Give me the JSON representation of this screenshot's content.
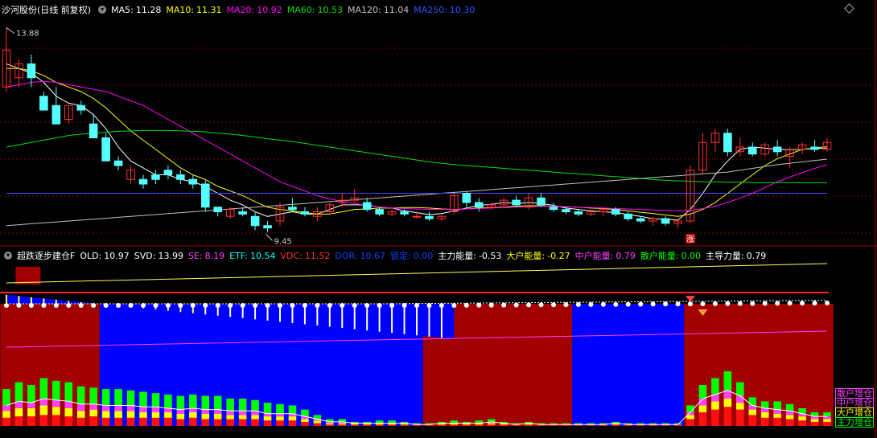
{
  "header_main": {
    "name": "沙河股份(日线 前复权)",
    "items": [
      {
        "label": "MA5:",
        "value": "11.28",
        "color": "#ffffff"
      },
      {
        "label": "MA10:",
        "value": "11.31",
        "color": "#ffff00"
      },
      {
        "label": "MA20:",
        "value": "10.92",
        "color": "#ff00ff"
      },
      {
        "label": "MA60:",
        "value": "10.53",
        "color": "#00e000"
      },
      {
        "label": "MA120:",
        "value": "11.04",
        "color": "#c0c0c0"
      },
      {
        "label": "MA250:",
        "value": "10.30",
        "color": "#3050ff"
      }
    ]
  },
  "header_sub": {
    "name": "超跌逐步建仓F",
    "items": [
      {
        "label": "OLD:",
        "value": "10.97",
        "color": "#ffffff"
      },
      {
        "label": "SVD:",
        "value": "13.99",
        "color": "#ffffff"
      },
      {
        "label": "SE:",
        "value": "8.19",
        "color": "#ff40ff"
      },
      {
        "label": "ETF:",
        "value": "10.54",
        "color": "#00ffff"
      },
      {
        "label": "VDC:",
        "value": "11.52",
        "color": "#ff3030"
      },
      {
        "label": "DOR:",
        "value": "10.67",
        "color": "#1040ff"
      },
      {
        "label": "锁定:",
        "value": "0.00",
        "color": "#1040ff"
      },
      {
        "label": "主力能量:",
        "value": "-0.53",
        "color": "#ffffff"
      },
      {
        "label": "大户能量:",
        "value": "-0.27",
        "color": "#ffff00"
      },
      {
        "label": "中户能量:",
        "value": "0.79",
        "color": "#ff40ff"
      },
      {
        "label": "散户能量:",
        "value": "0.00",
        "color": "#00ff00"
      },
      {
        "label": "主导力量:",
        "value": "0.79",
        "color": "#ffffff"
      }
    ]
  },
  "annotations": {
    "high": "13.88",
    "low": "9.45",
    "zhang": "涨"
  },
  "legend": [
    {
      "text": "散户增仓",
      "color": "#ff40ff"
    },
    {
      "text": "中户增仓",
      "color": "#ff40ff"
    },
    {
      "text": "大户增仓",
      "color": "#ffff00"
    },
    {
      "text": "主力增仓",
      "color": "#00ff00"
    }
  ],
  "chart_data": {
    "type": "candlestick",
    "candles": [
      [
        12.6,
        13.9,
        12.5,
        13.4
      ],
      [
        12.8,
        13.2,
        12.6,
        13.1
      ],
      [
        13.1,
        13.3,
        12.6,
        12.8
      ],
      [
        12.4,
        12.5,
        12.1,
        12.1
      ],
      [
        12.2,
        12.6,
        11.8,
        11.8
      ],
      [
        11.9,
        12.2,
        11.8,
        12.2
      ],
      [
        12.2,
        12.3,
        12.0,
        12.1
      ],
      [
        11.8,
        12.0,
        11.5,
        11.5
      ],
      [
        11.5,
        11.6,
        11.0,
        11.0
      ],
      [
        11.0,
        11.1,
        10.8,
        10.9
      ],
      [
        10.6,
        10.9,
        10.5,
        10.8
      ],
      [
        10.6,
        10.7,
        10.4,
        10.5
      ],
      [
        10.7,
        10.8,
        10.5,
        10.6
      ],
      [
        10.8,
        10.9,
        10.6,
        10.7
      ],
      [
        10.7,
        10.8,
        10.5,
        10.6
      ],
      [
        10.6,
        10.7,
        10.4,
        10.5
      ],
      [
        10.5,
        10.6,
        9.9,
        10.0
      ],
      [
        10.0,
        10.0,
        9.8,
        9.9
      ],
      [
        9.8,
        10.0,
        9.75,
        9.95
      ],
      [
        9.9,
        10.0,
        9.8,
        9.85
      ],
      [
        9.8,
        9.9,
        9.5,
        9.6
      ],
      [
        9.6,
        9.7,
        9.45,
        9.55
      ],
      [
        9.7,
        10.1,
        9.6,
        10.0
      ],
      [
        10.0,
        10.2,
        9.9,
        9.95
      ],
      [
        9.9,
        10.0,
        9.8,
        9.85
      ],
      [
        9.8,
        10.0,
        9.7,
        9.9
      ],
      [
        9.9,
        10.1,
        9.85,
        10.05
      ],
      [
        10.1,
        10.3,
        10.0,
        10.15
      ],
      [
        10.15,
        10.4,
        10.1,
        10.2
      ],
      [
        10.1,
        10.2,
        9.9,
        9.95
      ],
      [
        9.95,
        10.0,
        9.8,
        9.85
      ],
      [
        9.85,
        9.95,
        9.8,
        9.9
      ],
      [
        9.9,
        9.95,
        9.8,
        9.85
      ],
      [
        9.8,
        9.9,
        9.75,
        9.8
      ],
      [
        9.8,
        9.9,
        9.7,
        9.75
      ],
      [
        9.75,
        9.85,
        9.7,
        9.8
      ],
      [
        9.9,
        10.3,
        9.85,
        10.25
      ],
      [
        10.3,
        10.35,
        10.0,
        10.1
      ],
      [
        10.1,
        10.2,
        9.9,
        10.0
      ],
      [
        10.0,
        10.1,
        9.95,
        10.05
      ],
      [
        10.05,
        10.2,
        10.0,
        10.15
      ],
      [
        10.15,
        10.25,
        10.0,
        10.05
      ],
      [
        10.0,
        10.3,
        9.95,
        10.2
      ],
      [
        10.2,
        10.3,
        10.0,
        10.05
      ],
      [
        10.0,
        10.1,
        9.9,
        9.95
      ],
      [
        9.95,
        10.0,
        9.85,
        9.9
      ],
      [
        9.9,
        9.95,
        9.8,
        9.85
      ],
      [
        9.85,
        9.95,
        9.8,
        9.9
      ],
      [
        9.9,
        10.0,
        9.8,
        9.95
      ],
      [
        9.95,
        10.0,
        9.8,
        9.85
      ],
      [
        9.85,
        9.9,
        9.7,
        9.75
      ],
      [
        9.75,
        9.8,
        9.65,
        9.7
      ],
      [
        9.7,
        9.8,
        9.6,
        9.75
      ],
      [
        9.75,
        9.8,
        9.6,
        9.65
      ],
      [
        9.65,
        9.75,
        9.55,
        9.7
      ],
      [
        9.7,
        10.9,
        9.65,
        10.8
      ],
      [
        10.8,
        11.6,
        10.7,
        11.4
      ],
      [
        11.4,
        11.7,
        11.2,
        11.6
      ],
      [
        11.6,
        11.7,
        11.1,
        11.2
      ],
      [
        11.2,
        11.5,
        11.1,
        11.3
      ],
      [
        11.3,
        11.4,
        11.1,
        11.15
      ],
      [
        11.15,
        11.4,
        11.1,
        11.35
      ],
      [
        11.3,
        11.45,
        11.1,
        11.2
      ],
      [
        11.1,
        11.3,
        10.85,
        11.25
      ],
      [
        11.25,
        11.4,
        11.15,
        11.35
      ],
      [
        11.3,
        11.45,
        11.2,
        11.25
      ],
      [
        11.25,
        11.5,
        11.2,
        11.4
      ]
    ],
    "ma_lines": [
      {
        "name": "MA5",
        "color": "#ffffff",
        "values": [
          13.1,
          13.0,
          12.9,
          12.7,
          12.4,
          12.25,
          12.2,
          12.0,
          11.7,
          11.3,
          11.0,
          10.85,
          10.7,
          10.7,
          10.6,
          10.55,
          10.45,
          10.3,
          10.15,
          10.05,
          9.9,
          9.8,
          9.85,
          9.9,
          9.85,
          9.85,
          9.95,
          10.05,
          10.05,
          10.05,
          10.0,
          9.98,
          9.92,
          9.88,
          9.84,
          9.86,
          9.92,
          9.98,
          10.04,
          10.06,
          10.1,
          10.08,
          10.1,
          10.08,
          10.04,
          9.98,
          9.95,
          9.92,
          9.9,
          9.88,
          9.84,
          9.8,
          9.75,
          9.74,
          9.72,
          9.95,
          10.3,
          10.7,
          11.0,
          11.25,
          11.3,
          11.28,
          11.25,
          11.24,
          11.25,
          11.27,
          11.28
        ]
      },
      {
        "name": "MA10",
        "color": "#ffff00",
        "values": [
          13.0,
          13.0,
          12.95,
          12.85,
          12.7,
          12.6,
          12.5,
          12.35,
          12.15,
          11.9,
          11.65,
          11.45,
          11.25,
          11.05,
          10.85,
          10.7,
          10.6,
          10.45,
          10.35,
          10.25,
          10.12,
          10.0,
          9.95,
          9.92,
          9.88,
          9.85,
          9.85,
          9.9,
          9.95,
          9.96,
          9.98,
          9.98,
          9.99,
          9.99,
          9.98,
          9.96,
          9.95,
          9.96,
          9.98,
          9.99,
          10.0,
          10.02,
          10.03,
          10.03,
          10.02,
          10.01,
          10.0,
          9.98,
          9.97,
          9.95,
          9.92,
          9.89,
          9.86,
          9.83,
          9.8,
          9.85,
          9.95,
          10.1,
          10.3,
          10.5,
          10.7,
          10.9,
          11.05,
          11.15,
          11.25,
          11.28,
          11.31
        ]
      },
      {
        "name": "MA20",
        "color": "#ff00ff",
        "values": [
          12.6,
          12.65,
          12.7,
          12.72,
          12.7,
          12.65,
          12.6,
          12.55,
          12.5,
          12.4,
          12.3,
          12.2,
          12.05,
          11.9,
          11.75,
          11.6,
          11.45,
          11.3,
          11.15,
          11.0,
          10.85,
          10.7,
          10.55,
          10.45,
          10.35,
          10.25,
          10.18,
          10.12,
          10.08,
          10.04,
          10.0,
          9.98,
          9.97,
          9.96,
          9.95,
          9.95,
          9.95,
          9.96,
          9.97,
          9.98,
          9.99,
          10.0,
          10.01,
          10.02,
          10.02,
          10.01,
          10.0,
          9.99,
          9.98,
          9.97,
          9.96,
          9.95,
          9.94,
          9.93,
          9.92,
          9.93,
          9.97,
          10.02,
          10.1,
          10.2,
          10.3,
          10.42,
          10.55,
          10.65,
          10.75,
          10.84,
          10.92
        ]
      },
      {
        "name": "MA60",
        "color": "#00e000",
        "values": [
          11.3,
          11.35,
          11.4,
          11.45,
          11.5,
          11.55,
          11.58,
          11.6,
          11.62,
          11.64,
          11.65,
          11.66,
          11.66,
          11.66,
          11.65,
          11.64,
          11.63,
          11.6,
          11.58,
          11.55,
          11.52,
          11.48,
          11.45,
          11.42,
          11.38,
          11.34,
          11.3,
          11.26,
          11.22,
          11.18,
          11.14,
          11.1,
          11.06,
          11.02,
          10.98,
          10.95,
          10.92,
          10.9,
          10.88,
          10.86,
          10.84,
          10.82,
          10.8,
          10.78,
          10.76,
          10.74,
          10.72,
          10.7,
          10.68,
          10.66,
          10.64,
          10.62,
          10.6,
          10.58,
          10.57,
          10.56,
          10.55,
          10.55,
          10.54,
          10.54,
          10.53,
          10.53,
          10.53,
          10.53,
          10.53,
          10.53,
          10.53
        ]
      },
      {
        "name": "MA120",
        "color": "#c0c0c0",
        "values": [
          9.6,
          9.62,
          9.64,
          9.66,
          9.68,
          9.7,
          9.72,
          9.74,
          9.76,
          9.78,
          9.8,
          9.82,
          9.84,
          9.86,
          9.88,
          9.9,
          9.92,
          9.94,
          9.96,
          9.98,
          10.0,
          10.02,
          10.04,
          10.06,
          10.08,
          10.1,
          10.12,
          10.14,
          10.16,
          10.18,
          10.2,
          10.22,
          10.24,
          10.26,
          10.28,
          10.3,
          10.32,
          10.34,
          10.36,
          10.38,
          10.4,
          10.42,
          10.44,
          10.46,
          10.48,
          10.5,
          10.52,
          10.54,
          10.56,
          10.58,
          10.6,
          10.62,
          10.64,
          10.66,
          10.68,
          10.7,
          10.72,
          10.74,
          10.76,
          10.8,
          10.84,
          10.88,
          10.92,
          10.95,
          10.98,
          11.01,
          11.04
        ]
      },
      {
        "name": "MA250",
        "color": "#3050ff",
        "values": [
          10.3,
          10.3,
          10.3,
          10.3,
          10.3,
          10.3,
          10.3,
          10.3,
          10.3,
          10.3,
          10.3,
          10.3,
          10.3,
          10.3,
          10.3,
          10.3,
          10.3,
          10.3,
          10.3,
          10.3,
          10.3,
          10.3,
          10.3,
          10.3,
          10.3,
          10.3,
          10.3,
          10.3,
          10.3,
          10.3,
          10.3,
          10.3,
          10.3,
          10.3,
          10.3,
          10.3,
          10.3,
          10.3,
          10.3,
          10.3,
          10.3,
          10.3,
          10.3,
          10.3,
          10.3,
          10.3,
          10.3,
          10.3,
          10.3,
          10.3,
          10.3,
          10.3,
          10.3,
          10.3,
          10.3,
          10.3,
          10.3,
          10.3,
          10.3,
          10.3,
          10.3,
          10.3,
          10.3,
          10.3,
          10.3,
          10.3,
          10.3
        ]
      }
    ],
    "sub_regions": [
      {
        "color": "#a00000",
        "from": 0,
        "to": 7
      },
      {
        "color": "#0000ff",
        "from": 8,
        "to": 33
      },
      {
        "color": "#a00000",
        "from": 34,
        "to": 45
      },
      {
        "color": "#0000ff",
        "from": 46,
        "to": 54
      },
      {
        "color": "#a00000",
        "from": 55,
        "to": 66
      }
    ],
    "stacked_bars": [
      [
        6,
        5,
        4,
        12
      ],
      [
        7,
        6,
        5,
        14
      ],
      [
        7,
        6,
        4,
        13
      ],
      [
        8,
        7,
        5,
        15
      ],
      [
        8,
        6,
        5,
        14
      ],
      [
        7,
        6,
        5,
        14
      ],
      [
        6,
        5,
        5,
        13
      ],
      [
        7,
        5,
        4,
        12
      ],
      [
        6,
        5,
        4,
        12
      ],
      [
        6,
        5,
        4,
        12
      ],
      [
        6,
        5,
        4,
        11
      ],
      [
        6,
        4,
        4,
        11
      ],
      [
        6,
        4,
        4,
        10
      ],
      [
        6,
        4,
        3,
        10
      ],
      [
        5,
        4,
        3,
        10
      ],
      [
        6,
        4,
        3,
        10
      ],
      [
        5,
        4,
        3,
        10
      ],
      [
        5,
        4,
        3,
        10
      ],
      [
        5,
        3,
        3,
        9
      ],
      [
        5,
        3,
        3,
        9
      ],
      [
        5,
        3,
        3,
        8
      ],
      [
        4,
        3,
        2,
        8
      ],
      [
        4,
        3,
        2,
        7
      ],
      [
        4,
        3,
        2,
        6
      ],
      [
        3,
        2,
        2,
        5
      ],
      [
        2,
        2,
        1,
        3
      ],
      [
        1,
        1,
        1,
        2
      ],
      [
        1,
        1,
        1,
        2
      ],
      [
        1,
        1,
        0,
        1
      ],
      [
        1,
        1,
        0,
        1
      ],
      [
        1,
        1,
        0,
        2
      ],
      [
        1,
        1,
        0,
        2
      ],
      [
        1,
        1,
        0,
        1
      ],
      [
        1,
        0,
        0,
        1
      ],
      [
        1,
        0,
        0,
        1
      ],
      [
        1,
        1,
        0,
        1
      ],
      [
        1,
        1,
        0,
        2
      ],
      [
        1,
        1,
        0,
        1
      ],
      [
        1,
        1,
        0,
        2
      ],
      [
        1,
        1,
        1,
        2
      ],
      [
        1,
        1,
        0,
        1
      ],
      [
        1,
        0,
        0,
        1
      ],
      [
        1,
        1,
        0,
        1
      ],
      [
        1,
        0,
        0,
        1
      ],
      [
        1,
        0,
        0,
        1
      ],
      [
        1,
        0,
        0,
        1
      ],
      [
        1,
        0,
        0,
        1
      ],
      [
        1,
        0,
        0,
        1
      ],
      [
        1,
        0,
        0,
        1
      ],
      [
        1,
        1,
        0,
        1
      ],
      [
        1,
        0,
        0,
        1
      ],
      [
        1,
        0,
        0,
        1
      ],
      [
        1,
        0,
        0,
        1
      ],
      [
        1,
        0,
        0,
        1
      ],
      [
        1,
        0,
        0,
        1
      ],
      [
        5,
        3,
        2,
        5
      ],
      [
        10,
        5,
        5,
        10
      ],
      [
        12,
        6,
        5,
        12
      ],
      [
        14,
        6,
        6,
        14
      ],
      [
        12,
        5,
        5,
        10
      ],
      [
        8,
        4,
        3,
        6
      ],
      [
        6,
        4,
        3,
        5
      ],
      [
        6,
        3,
        3,
        6
      ],
      [
        5,
        3,
        3,
        5
      ],
      [
        4,
        3,
        2,
        4
      ],
      [
        3,
        2,
        2,
        3
      ],
      [
        3,
        2,
        2,
        3
      ]
    ],
    "sub_axis": [
      0,
      120
    ],
    "main_axis": [
      9.3,
      14.1
    ]
  }
}
